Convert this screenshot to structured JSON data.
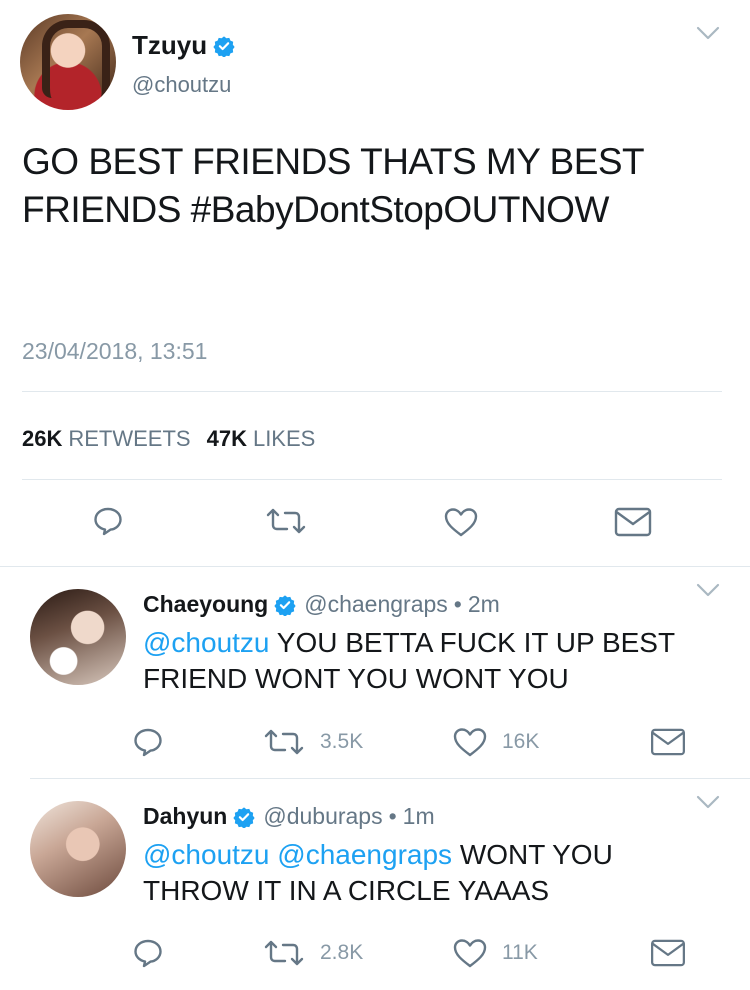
{
  "main_tweet": {
    "name": "Tzuyu",
    "handle": "@choutzu",
    "text": "GO BEST FRIENDS THATS MY BEST FRIENDS #BabyDontStopOUTNOW",
    "timestamp": "23/04/2018, 13:51",
    "retweets_count": "26K",
    "retweets_label": "RETWEETS",
    "likes_count": "47K",
    "likes_label": "LIKES"
  },
  "replies": [
    {
      "name": "Chaeyoung",
      "handle": "@chaengraps",
      "time": "2m",
      "mention1": "@choutzu",
      "mention2": "",
      "text": "YOU BETTA FUCK IT UP BEST FRIEND WONT YOU WONT YOU",
      "retweets": "3.5K",
      "likes": "16K"
    },
    {
      "name": "Dahyun",
      "handle": "@duburaps",
      "time": "1m",
      "mention1": "@choutzu",
      "mention2": "@chaengraps",
      "text": "WONT YOU THROW IT IN A CIRCLE YAAAS",
      "retweets": "2.8K",
      "likes": "11K"
    }
  ],
  "icons": {
    "verified": "verified-badge-icon",
    "chevron": "chevron-down-icon",
    "reply": "reply-icon",
    "retweet": "retweet-icon",
    "like": "heart-icon",
    "dm": "envelope-icon"
  },
  "colors": {
    "accent": "#1da1f2",
    "text": "#14171a",
    "muted": "#657786",
    "icon": "#657786"
  }
}
